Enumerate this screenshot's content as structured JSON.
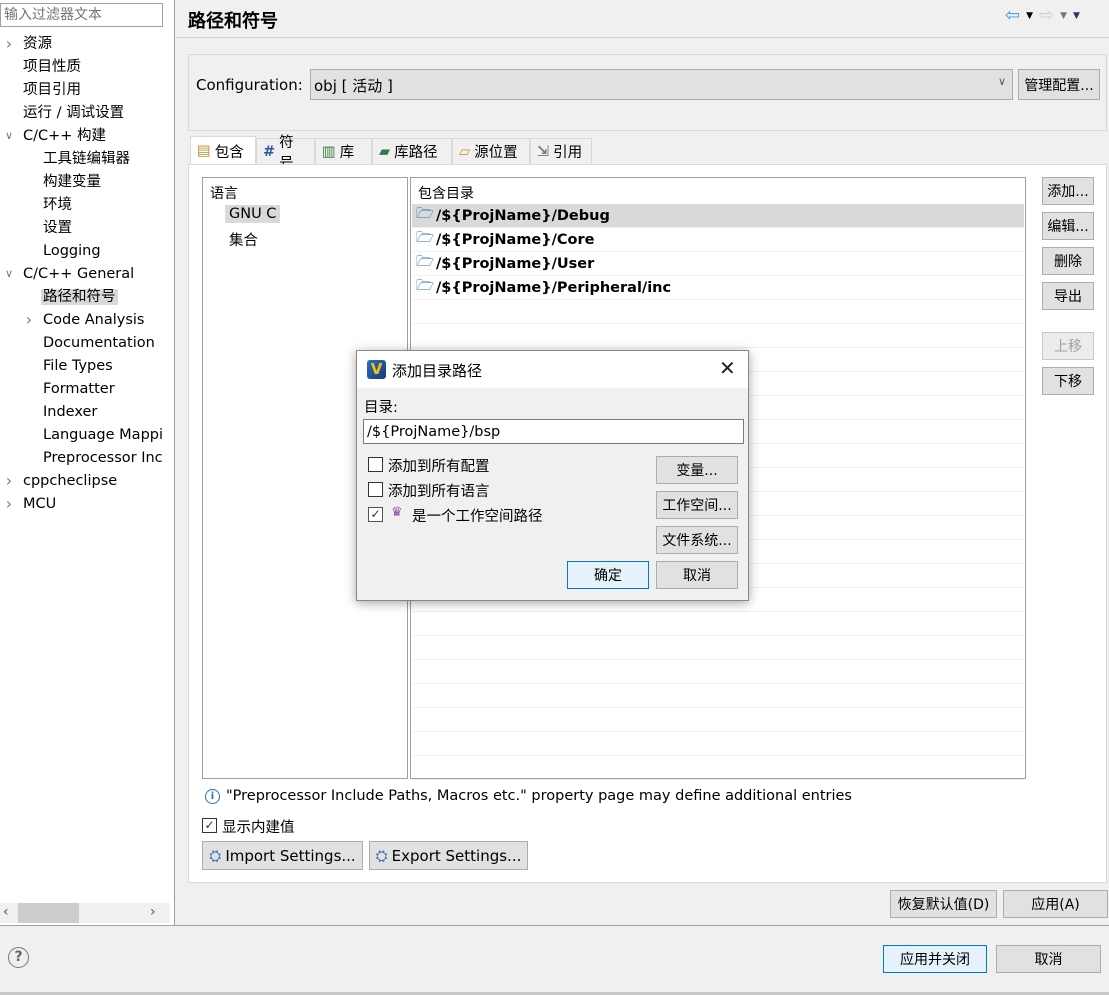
{
  "sidebar": {
    "filter_placeholder": "输入过滤器文本",
    "items": [
      {
        "label": "资源",
        "level": 0,
        "chevron": "right"
      },
      {
        "label": "项目性质",
        "level": 0
      },
      {
        "label": "项目引用",
        "level": 0
      },
      {
        "label": "运行 / 调试设置",
        "level": 0
      },
      {
        "label": "C/C++ 构建",
        "level": 0,
        "chevron": "down"
      },
      {
        "label": "工具链编辑器",
        "level": 1
      },
      {
        "label": "构建变量",
        "level": 1
      },
      {
        "label": "环境",
        "level": 1
      },
      {
        "label": "设置",
        "level": 1
      },
      {
        "label": "Logging",
        "level": 1
      },
      {
        "label": "C/C++ General",
        "level": 0,
        "chevron": "down"
      },
      {
        "label": "路径和符号",
        "level": 1,
        "selected": true
      },
      {
        "label": "Code Analysis",
        "level": 1,
        "chevron": "right"
      },
      {
        "label": "Documentation",
        "level": 1
      },
      {
        "label": "File Types",
        "level": 1
      },
      {
        "label": "Formatter",
        "level": 1
      },
      {
        "label": "Indexer",
        "level": 1
      },
      {
        "label": "Language Mappi",
        "level": 1
      },
      {
        "label": "Preprocessor Inc",
        "level": 1
      },
      {
        "label": "cppcheclipse",
        "level": 0,
        "chevron": "right"
      },
      {
        "label": "MCU",
        "level": 0,
        "chevron": "right"
      }
    ]
  },
  "header": {
    "title": "路径和符号",
    "nav_icons": [
      "back-arrow-icon",
      "forward-arrow-icon",
      "menu-dropdown-icon"
    ]
  },
  "config": {
    "label": "Configuration:",
    "value": "obj  [ 活动 ]",
    "manage_label": "管理配置..."
  },
  "tabs": [
    {
      "label": "包含",
      "icon": "include-icon",
      "active": true
    },
    {
      "label": "符号",
      "icon": "hash-icon"
    },
    {
      "label": "库",
      "icon": "library-icon"
    },
    {
      "label": "库路径",
      "icon": "library-path-icon"
    },
    {
      "label": "源位置",
      "icon": "source-folder-icon"
    },
    {
      "label": "引用",
      "icon": "reference-icon"
    }
  ],
  "languages": {
    "header": "语言",
    "items": [
      "GNU C",
      "集合"
    ],
    "selected": "GNU C"
  },
  "includes": {
    "header": "包含目录",
    "items": [
      "/${ProjName}/Debug",
      "/${ProjName}/Core",
      "/${ProjName}/User",
      "/${ProjName}/Peripheral/inc"
    ]
  },
  "side_buttons": [
    {
      "label": "添加...",
      "enabled": true
    },
    {
      "label": "编辑...",
      "enabled": true
    },
    {
      "label": "删除",
      "enabled": true
    },
    {
      "label": "导出",
      "enabled": true
    },
    {
      "label": "上移",
      "enabled": false
    },
    {
      "label": "下移",
      "enabled": true
    }
  ],
  "info_text": "\"Preprocessor Include Paths, Macros etc.\" property page may define additional entries",
  "show_builtin": {
    "label": "显示内建值",
    "checked": true
  },
  "import_label": "Import Settings...",
  "export_label": "Export Settings...",
  "restore_label": "恢复默认值(D)",
  "apply_label": "应用(A)",
  "apply_close_label": "应用并关闭",
  "cancel_label": "取消",
  "dialog": {
    "title": "添加目录路径",
    "dir_label": "目录:",
    "dir_value": "/${ProjName}/bsp",
    "checks": [
      {
        "label": "添加到所有配置",
        "checked": false
      },
      {
        "label": "添加到所有语言",
        "checked": false
      },
      {
        "label": "是一个工作空间路径",
        "checked": true
      }
    ],
    "variables_label": "变量...",
    "workspace_label": "工作空间...",
    "filesystem_label": "文件系统...",
    "ok_label": "确定",
    "cancel_label": "取消"
  },
  "colors": {
    "accent": "#0078d7",
    "selection": "#d9d9d9"
  }
}
